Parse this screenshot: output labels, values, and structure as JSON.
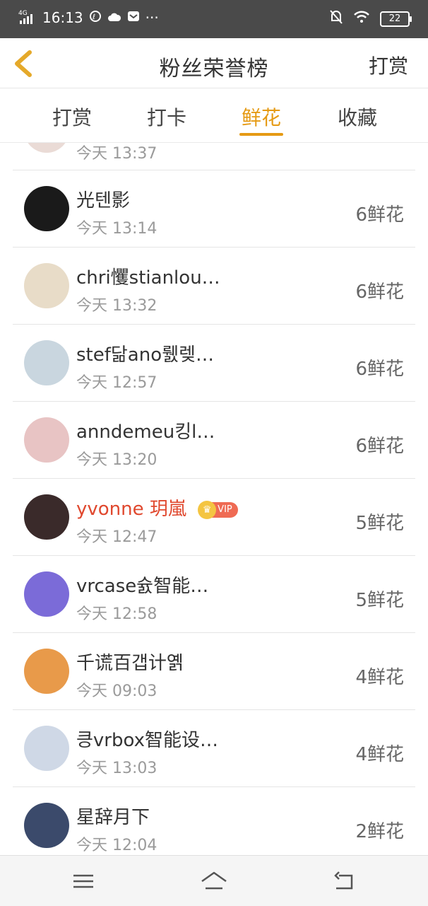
{
  "status_bar": {
    "network": "4G HD",
    "time": "16:13",
    "more": "···",
    "battery": "22"
  },
  "header": {
    "title": "粉丝荣誉榜",
    "right_action": "打赏"
  },
  "tabs": [
    {
      "label": "打赏",
      "active": false
    },
    {
      "label": "打卡",
      "active": false
    },
    {
      "label": "鲜花",
      "active": true
    },
    {
      "label": "收藏",
      "active": false
    }
  ],
  "partial_top_row": {
    "time": "今天 13:37"
  },
  "rows": [
    {
      "name": "光텐影",
      "time": "今天 13:14",
      "count": "6鲜花",
      "vip": false,
      "avatar_color": "#1a1a1a"
    },
    {
      "name": "chri戄stianlou…",
      "time": "今天 13:32",
      "count": "6鲜花",
      "vip": false,
      "avatar_color": "#e8dcc8"
    },
    {
      "name": "stef닮ano뤬렞…",
      "time": "今天 12:57",
      "count": "6鲜花",
      "vip": false,
      "avatar_color": "#c9d6df"
    },
    {
      "name": "anndemeu킹l…",
      "time": "今天 13:20",
      "count": "6鲜花",
      "vip": false,
      "avatar_color": "#e8c4c4"
    },
    {
      "name": "yvonne 玥嵐",
      "time": "今天 12:47",
      "count": "5鲜花",
      "vip": true,
      "vip_label": "VIP",
      "avatar_color": "#3a2a2a"
    },
    {
      "name": "vrcase슔智能…",
      "time": "今天 12:58",
      "count": "5鲜花",
      "vip": false,
      "avatar_color": "#7b6bd8"
    },
    {
      "name": "千谎百갭计옑",
      "time": "今天 09:03",
      "count": "4鲜花",
      "vip": false,
      "avatar_color": "#e89a4a"
    },
    {
      "name": "킁vrbox智能设…",
      "time": "今天 13:03",
      "count": "4鲜花",
      "vip": false,
      "avatar_color": "#cfd8e6"
    },
    {
      "name": "星辞月下",
      "time": "今天 12:04",
      "count": "2鲜花",
      "vip": false,
      "avatar_color": "#3b4a6b"
    }
  ],
  "colors": {
    "accent": "#e59a14",
    "vip_name": "#e0482e",
    "status_bar_bg": "#4a4a4a"
  }
}
